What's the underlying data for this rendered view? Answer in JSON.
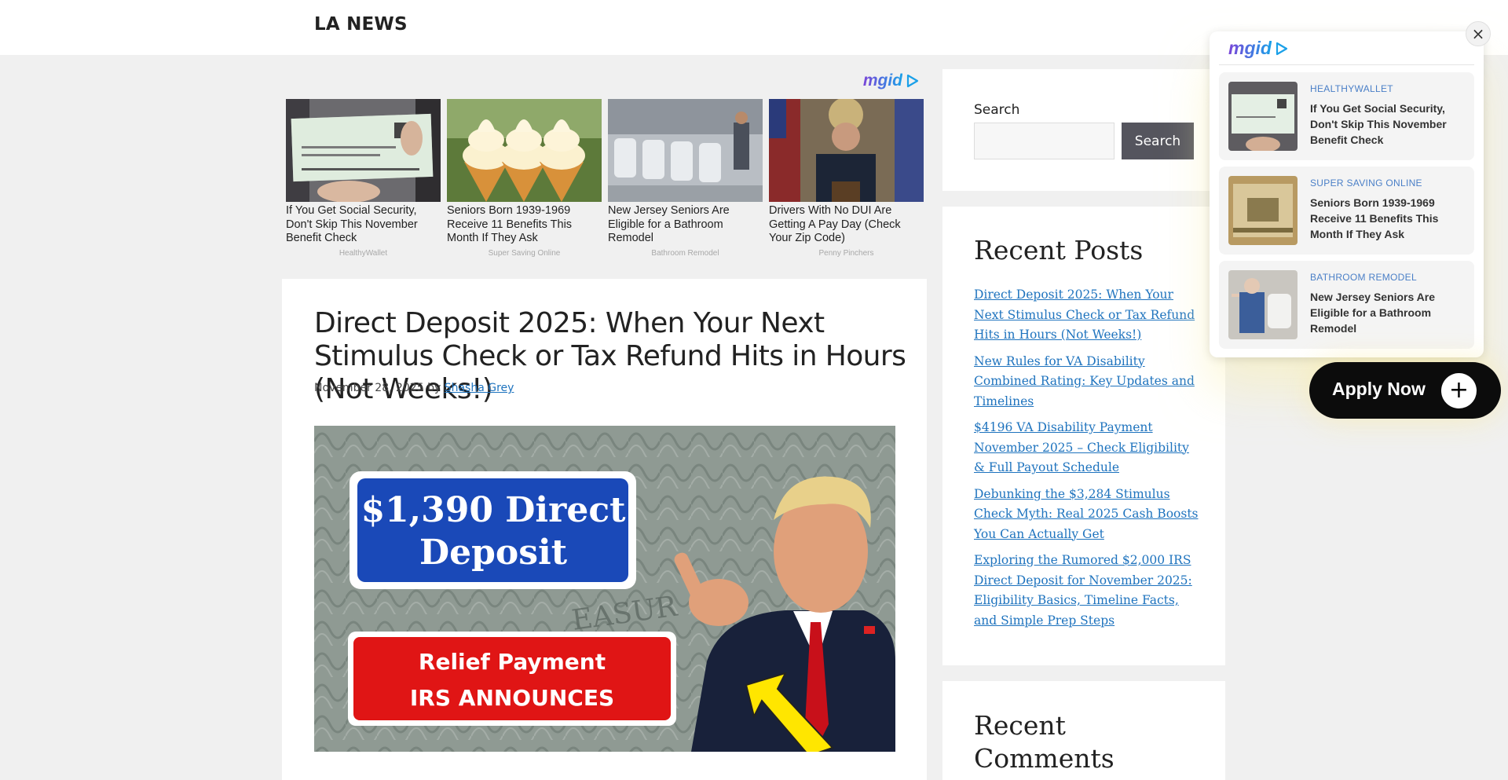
{
  "site": {
    "title": "LA NEWS"
  },
  "ad_strip": {
    "brand": "mgid",
    "cards": [
      {
        "title": "If You Get Social Security, Don't Skip This November Benefit Check",
        "source": "HealthyWallet"
      },
      {
        "title": "Seniors Born 1939-1969 Receive 11 Benefits This Month If They Ask",
        "source": "Super Saving Online"
      },
      {
        "title": "New Jersey Seniors Are Eligible for a Bathroom Remodel",
        "source": "Bathroom Remodel"
      },
      {
        "title": "Drivers With No DUI Are Getting A Pay Day (Check Your Zip Code)",
        "source": "Penny Pinchers"
      }
    ]
  },
  "article": {
    "title": "Direct Deposit 2025: When Your Next Stimulus Check or Tax Refund Hits in Hours (Not Weeks!)",
    "date": "November 28, 2025",
    "by": "by",
    "author": "Shasha Grey",
    "hero": {
      "badge_top": "$1,390 Direct Deposit",
      "badge_line1": "$1,390 Direct",
      "badge_line2": "Deposit",
      "banner_line1": "Relief Payment",
      "banner_line2": "IRS ANNOUNCES",
      "bg_text": "EASUR"
    }
  },
  "sidebar": {
    "search": {
      "label": "Search",
      "button": "Search",
      "placeholder": ""
    },
    "recent_posts": {
      "heading": "Recent Posts",
      "items": [
        "Direct Deposit 2025: When Your Next Stimulus Check or Tax Refund Hits in Hours (Not Weeks!)",
        "New Rules for VA Disability Combined Rating: Key Updates and Timelines",
        "$4196 VA Disability Payment November 2025 – Check Eligibility & Full Payout Schedule",
        "Debunking the $3,284 Stimulus Check Myth: Real 2025 Cash Boosts You Can Actually Get",
        "Exploring the Rumored $2,000 IRS Direct Deposit for November 2025: Eligibility Basics, Timeline Facts, and Simple Prep Steps"
      ]
    },
    "recent_comments": {
      "heading": "Recent Comments"
    }
  },
  "float_widget": {
    "brand": "mgid",
    "close": "×",
    "items": [
      {
        "source": "HEALTHYWALLET",
        "title": "If You Get Social Security, Don't Skip This November Benefit Check"
      },
      {
        "source": "SUPER SAVING ONLINE",
        "title": "Seniors Born 1939-1969 Receive 11 Benefits This Month If They Ask"
      },
      {
        "source": "BATHROOM REMODEL",
        "title": "New Jersey Seniors Are Eligible for a Bathroom Remodel"
      }
    ],
    "apply_label": "Apply Now",
    "apply_plus": "+"
  },
  "colors": {
    "link": "#1e73be",
    "search_button": "#55555e",
    "apply_button": "#0c0c0c",
    "mgid_purple": "#7a45d8",
    "mgid_blue": "#1aa0e8"
  }
}
